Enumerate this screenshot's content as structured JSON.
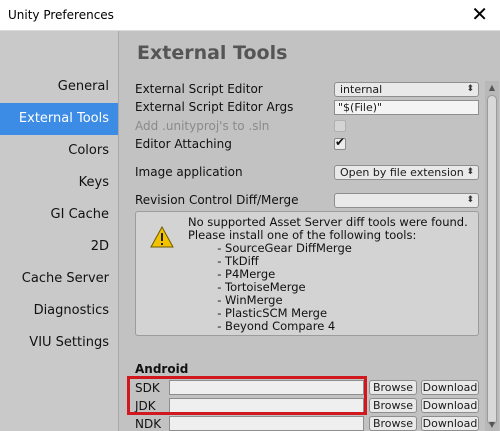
{
  "window": {
    "title": "Unity Preferences",
    "close_glyph": "✕"
  },
  "sidebar": {
    "items": [
      {
        "label": "General",
        "active": false
      },
      {
        "label": "External Tools",
        "active": true
      },
      {
        "label": "Colors",
        "active": false
      },
      {
        "label": "Keys",
        "active": false
      },
      {
        "label": "GI Cache",
        "active": false
      },
      {
        "label": "2D",
        "active": false
      },
      {
        "label": "Cache Server",
        "active": false
      },
      {
        "label": "Diagnostics",
        "active": false
      },
      {
        "label": "VIU Settings",
        "active": false
      }
    ]
  },
  "main": {
    "title": "External Tools",
    "external_script_editor": {
      "label": "External Script Editor",
      "value": "internal"
    },
    "external_script_editor_args": {
      "label": "External Script Editor Args",
      "value": "\"$(File)\""
    },
    "add_unityproj": {
      "label": "Add .unityproj's to .sln",
      "checked": false,
      "enabled": false
    },
    "editor_attaching": {
      "label": "Editor Attaching",
      "checked": true,
      "check_glyph": "✔"
    },
    "image_application": {
      "label": "Image application",
      "value": "Open by file extension"
    },
    "revision_control": {
      "label": "Revision Control Diff/Merge",
      "value": ""
    },
    "warning": {
      "icon": "warning-icon",
      "text": "No supported Asset Server diff tools were found.\nPlease install one of the following tools:\n        - SourceGear DiffMerge\n        - TkDiff\n        - P4Merge\n        - TortoiseMerge\n        - WinMerge\n        - PlasticSCM Merge\n        - Beyond Compare 4"
    },
    "android": {
      "heading": "Android",
      "rows": [
        {
          "label": "SDK",
          "browse": "Browse",
          "download": "Download"
        },
        {
          "label": "JDK",
          "browse": "Browse",
          "download": "Download"
        },
        {
          "label": "NDK",
          "browse": "Browse",
          "download": "Download"
        }
      ]
    }
  },
  "colors": {
    "accent": "#3c8ce6",
    "highlight": "#d0181e"
  },
  "dropdown_arrow": "⬍",
  "scrollbar_arrows": {
    "up": "▲",
    "down": "▼"
  }
}
